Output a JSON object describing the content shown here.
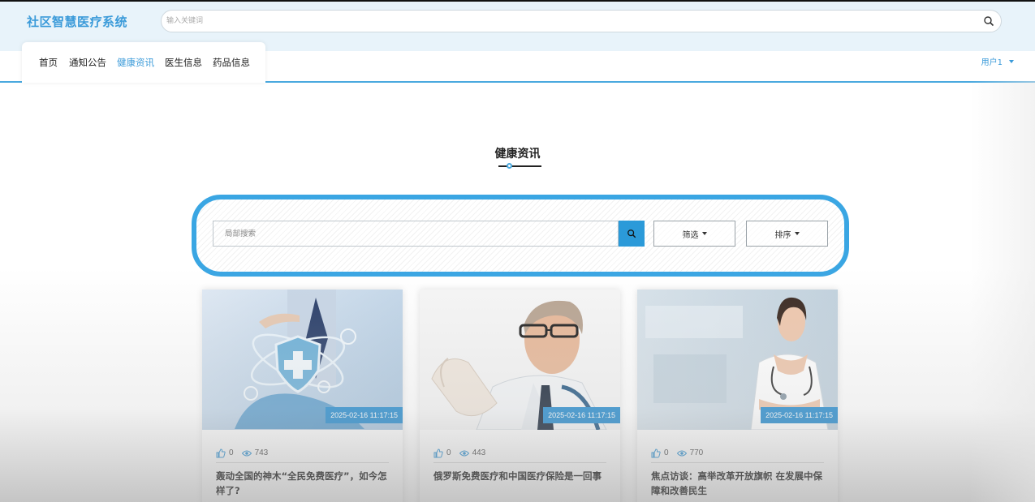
{
  "header": {
    "brand": "社区智慧医疗系统",
    "search_placeholder": "输入关键词"
  },
  "nav": {
    "items": [
      {
        "label": "首页"
      },
      {
        "label": "通知公告"
      },
      {
        "label": "健康资讯"
      },
      {
        "label": "医生信息"
      },
      {
        "label": "药品信息"
      }
    ],
    "active": "健康资讯",
    "user": "用户1"
  },
  "section": {
    "title": "健康资讯"
  },
  "filters": {
    "search_placeholder": "局部搜索",
    "filter_label": "筛选",
    "sort_label": "排序"
  },
  "cards": [
    {
      "date": "2025-02-16 11:17:15",
      "likes": "0",
      "views": "743",
      "title": "轰动全国的神木“全民免费医疗”，如今怎样了?"
    },
    {
      "date": "2025-02-16 11:17:15",
      "likes": "0",
      "views": "443",
      "title": "俄罗斯免费医疗和中国医疗保险是一回事"
    },
    {
      "date": "2025-02-16 11:17:15",
      "likes": "0",
      "views": "770",
      "title": "焦点访谈：高举改革开放旗帜 在发展中保障和改善民生"
    }
  ],
  "colors": {
    "accent": "#3a9ad9",
    "panel_border": "#3aa6e3",
    "badge": "#2b8fd0"
  }
}
